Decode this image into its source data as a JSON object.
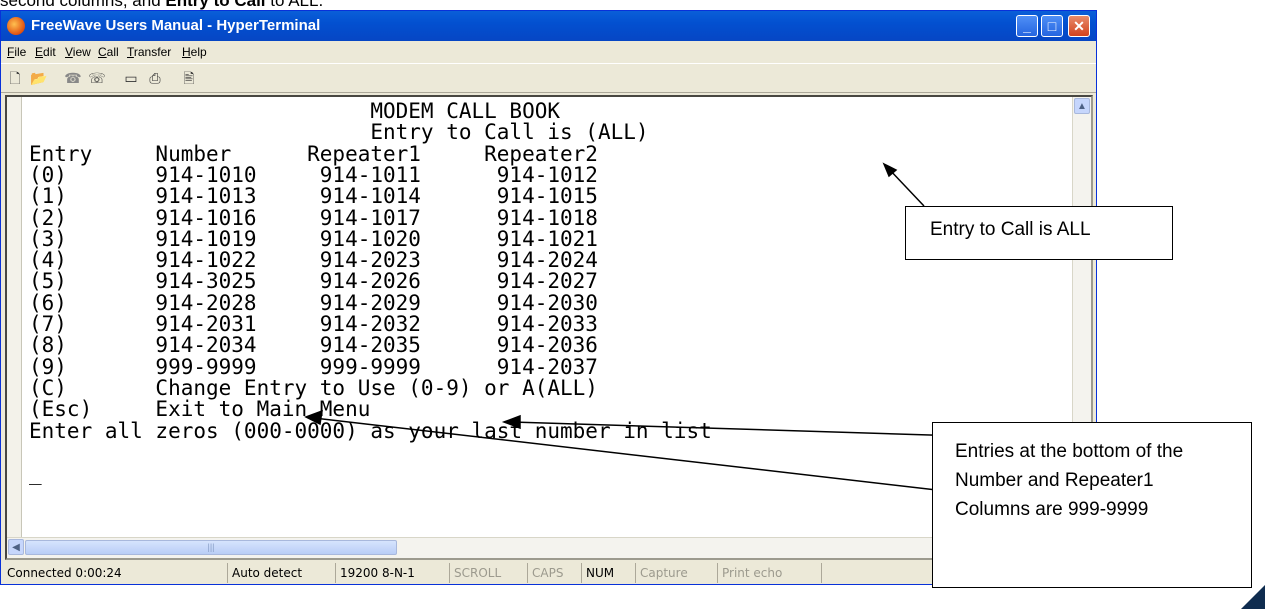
{
  "caption": {
    "text_before": "second columns, and ",
    "bold": "Entry to Call",
    "text_after": " to ALL."
  },
  "window": {
    "title": "FreeWave Users Manual - HyperTerminal",
    "buttons": {
      "minimize": "_",
      "maximize": "□",
      "close": "✕"
    }
  },
  "menu": [
    "File",
    "Edit",
    "View",
    "Call",
    "Transfer",
    "Help"
  ],
  "toolbar_icons": [
    "new-icon",
    "open-icon",
    "disconnect-icon",
    "dial-icon",
    "send-icon",
    "receive-icon",
    "properties-icon"
  ],
  "terminal": {
    "lines": [
      "                           MODEM CALL BOOK",
      "                           Entry to Call is (ALL)",
      "Entry     Number      Repeater1     Repeater2",
      "(0)       914-1010     914-1011      914-1012",
      "(1)       914-1013     914-1014      914-1015",
      "(2)       914-1016     914-1017      914-1018",
      "(3)       914-1019     914-1020      914-1021",
      "(4)       914-1022     914-2023      914-2024",
      "(5)       914-3025     914-2026      914-2027",
      "(6)       914-2028     914-2029      914-2030",
      "(7)       914-2031     914-2032      914-2033",
      "(8)       914-2034     914-2035      914-2036",
      "(9)       999-9999     999-9999      914-2037",
      "(C)       Change Entry to Use (0-9) or A(ALL)",
      "(Esc)     Exit to Main Menu",
      "Enter all zeros (000-0000) as your last number in list",
      "",
      "_"
    ]
  },
  "status": {
    "connected": "Connected 0:00:24",
    "detect": "Auto detect",
    "settings": "19200 8-N-1",
    "scroll": "SCROLL",
    "caps": "CAPS",
    "num": "NUM",
    "capture": "Capture",
    "print_echo": "Print echo"
  },
  "callouts": {
    "entry_all": "Entry to Call is ALL",
    "entries_bottom": "Entries at the bottom of the Number and Repeater1 Columns are 999-9999"
  }
}
